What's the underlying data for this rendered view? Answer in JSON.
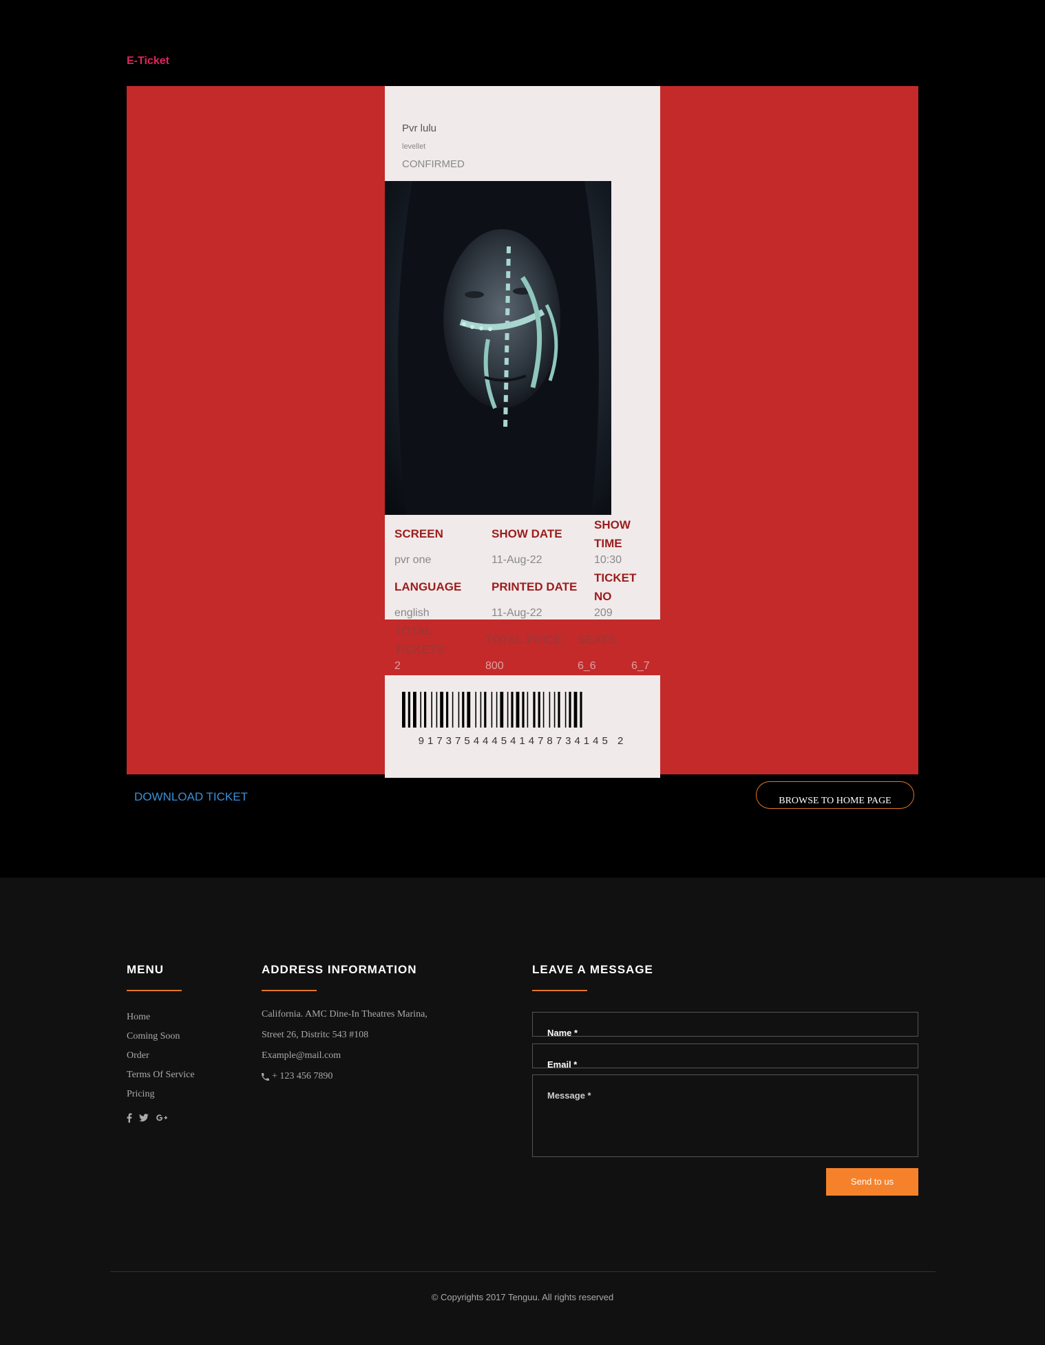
{
  "header": {
    "title": "E-Ticket"
  },
  "ticket": {
    "theatre": "Pvr lulu",
    "level": "levellet",
    "status": "CONFIRMED",
    "labels": {
      "screen": "SCREEN",
      "show_date": "SHOW DATE",
      "show_time_1": "SHOW",
      "show_time_2": "TIME",
      "language": "LANGUAGE",
      "printed_date": "PRINTED DATE",
      "ticket_no_1": "TICKET",
      "ticket_no_2": "NO",
      "total_tickets_1": "TOTAL",
      "total_tickets_2": "TICKETS",
      "total_price": "TOTAL PRICE",
      "seats": "SEATS"
    },
    "values": {
      "screen": "pvr one",
      "show_date": "11-Aug-22",
      "show_time": "10:30",
      "language": "english",
      "printed_date": "11-Aug-22",
      "ticket_no": "209",
      "total_tickets": "2",
      "total_price": "800",
      "seat_1": "6_6",
      "seat_2": "6_7"
    },
    "barcode_number": "917375444541478734145 2"
  },
  "actions": {
    "download": "DOWNLOAD TICKET",
    "browse_home": "BROWSE TO HOME PAGE"
  },
  "footer": {
    "menu": {
      "title": "MENU",
      "items": [
        "Home",
        "Coming Soon",
        "Order",
        "Terms Of Service",
        "Pricing"
      ]
    },
    "social_icons": [
      "facebook-icon",
      "twitter-icon",
      "google-plus-icon"
    ],
    "address": {
      "title": "ADDRESS INFORMATION",
      "line1": "California. AMC Dine-In Theatres Marina,",
      "line2": "Street 26, Distritc 543 #108",
      "email": "Example@mail.com",
      "phone": "+ 123 456 7890"
    },
    "message": {
      "title": "LEAVE A MESSAGE",
      "name_placeholder": "Name *",
      "email_placeholder": "Email *",
      "message_placeholder": "Message *",
      "send": "Send to us"
    },
    "copyright": "© Copyrights 2017 Tenguu. All rights reserved"
  },
  "colors": {
    "accent": "#e2762a",
    "panel_red": "#c42a2a",
    "label_red": "#9b1c1c",
    "title_pink": "#e0245e",
    "link_blue": "#3a8fd8"
  }
}
